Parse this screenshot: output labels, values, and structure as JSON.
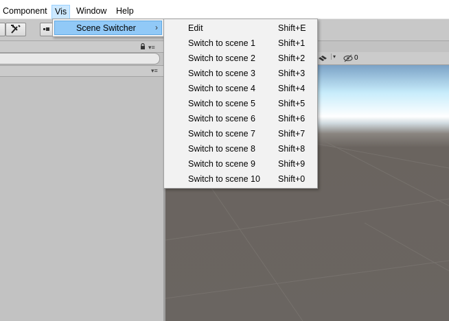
{
  "menubar": {
    "items": [
      {
        "label": "Component"
      },
      {
        "label": "Vis"
      },
      {
        "label": "Window"
      },
      {
        "label": "Help"
      }
    ]
  },
  "submenu": {
    "label": "Scene Switcher",
    "arrow": "›"
  },
  "menu": {
    "items": [
      {
        "label": "Edit",
        "shortcut": "Shift+E"
      },
      {
        "label": "Switch to scene 1",
        "shortcut": "Shift+1"
      },
      {
        "label": "Switch to scene 2",
        "shortcut": "Shift+2"
      },
      {
        "label": "Switch to scene 3",
        "shortcut": "Shift+3"
      },
      {
        "label": "Switch to scene 4",
        "shortcut": "Shift+4"
      },
      {
        "label": "Switch to scene 5",
        "shortcut": "Shift+5"
      },
      {
        "label": "Switch to scene 6",
        "shortcut": "Shift+6"
      },
      {
        "label": "Switch to scene 7",
        "shortcut": "Shift+7"
      },
      {
        "label": "Switch to scene 8",
        "shortcut": "Shift+8"
      },
      {
        "label": "Switch to scene 9",
        "shortcut": "Shift+9"
      },
      {
        "label": "Switch to scene 10",
        "shortcut": "Shift+0"
      }
    ]
  },
  "scene_toolbar": {
    "hidden_count": "0"
  },
  "colors": {
    "menu_highlight": "#91c9f7",
    "menubar_active": "#cce8ff",
    "panel_bg": "#c2c2c2",
    "ground": "#6a6561"
  },
  "icons": [
    "tools-icon",
    "pivot-icon",
    "lock-icon",
    "panel-menu-icon",
    "gizmos-icon",
    "visibility-icon",
    "scene-camera-icon",
    "submenu-arrow-icon"
  ]
}
